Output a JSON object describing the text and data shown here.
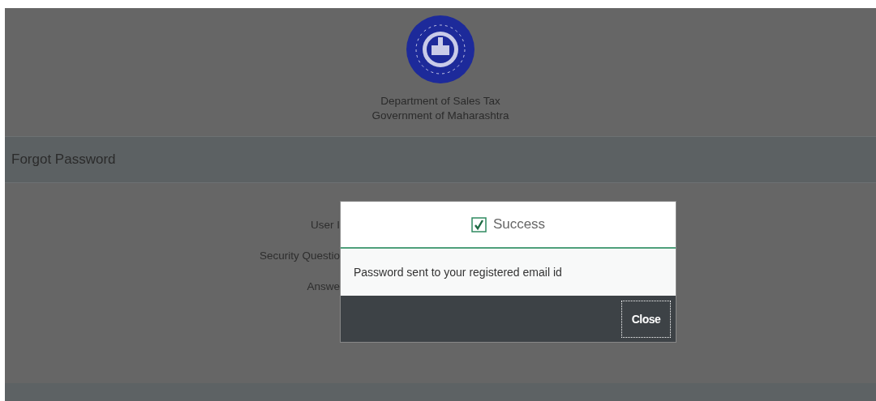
{
  "header": {
    "department": "Department of Sales Tax",
    "government": "Government of Maharashtra"
  },
  "panel": {
    "title": "Forgot Password",
    "fields": [
      {
        "label": "User I"
      },
      {
        "label": "Security Questio"
      },
      {
        "label": "Answe"
      }
    ]
  },
  "dialog": {
    "title": "Success",
    "message": "Password sent to your registered email id",
    "buttons": [
      {
        "label": "Close",
        "focused": true
      }
    ]
  }
}
